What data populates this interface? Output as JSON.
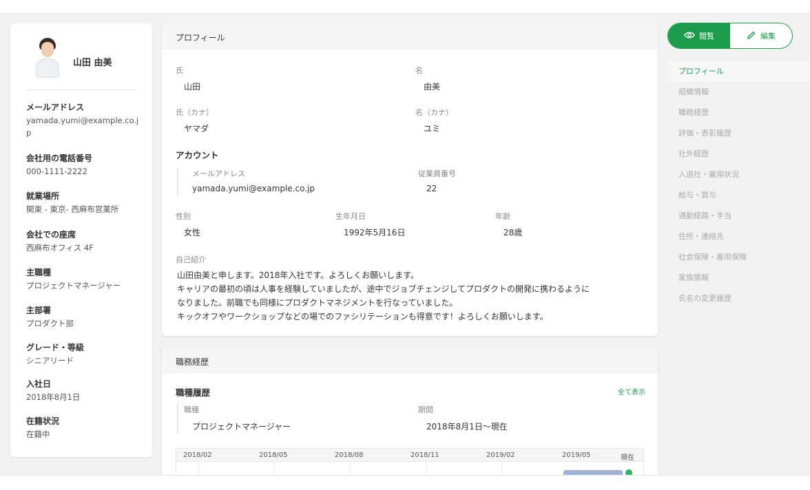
{
  "left": {
    "name": "山田 由美",
    "fields": [
      {
        "label": "メールアドレス",
        "value": "yamada.yumi@example.co.jp"
      },
      {
        "label": "会社用の電話番号",
        "value": "000-1111-2222"
      },
      {
        "label": "就業場所",
        "value": "関東 - 東京- 西麻布営業所"
      },
      {
        "label": "会社での座席",
        "value": "西麻布オフィス 4F"
      },
      {
        "label": "主職種",
        "value": "プロジェクトマネージャー"
      },
      {
        "label": "主部署",
        "value": "プロダクト部"
      },
      {
        "label": "グレード・等級",
        "value": "シニアリード"
      },
      {
        "label": "入社日",
        "value": "2018年8月1日"
      },
      {
        "label": "在籍状況",
        "value": "在籍中"
      }
    ]
  },
  "profile": {
    "header": "プロフィール",
    "last_name_label": "氏",
    "last_name": "山田",
    "first_name_label": "名",
    "first_name": "由美",
    "last_kana_label": "氏（カナ）",
    "last_kana": "ヤマダ",
    "first_kana_label": "名（カナ）",
    "first_kana": "ユミ",
    "account_title": "アカウント",
    "email_label": "メールアドレス",
    "email": "yamada.yumi@example.co.jp",
    "employee_no_label": "従業員番号",
    "employee_no": "22",
    "gender_label": "性別",
    "gender": "女性",
    "birthday_label": "生年月日",
    "birthday": "1992年5月16日",
    "age_label": "年齢",
    "age": "28歳",
    "intro_label": "自己紹介",
    "intro_lines": [
      "山田由美と申します。2018年入社です。よろしくお願いします。",
      "キャリアの最初の頃は人事を経験していましたが、途中でジョブチェンジしてプロダクトの開発に携わるように",
      "なりました。前職でも同様にプロダクトマネジメントを行なっていました。",
      "キックオフやワークショップなどの場でのファシリテーションも得意です！よろしくお願いします。"
    ]
  },
  "career": {
    "header": "職務経歴",
    "title": "職種履歴",
    "show_all": "全て表示",
    "job_label": "職種",
    "job": "プロジェクトマネージャー",
    "period_label": "期間",
    "period": "2018年8月1日〜現在",
    "timeline_ticks": [
      "2018/02",
      "2018/05",
      "2018/08",
      "2018/11",
      "2019/02",
      "2019/05",
      "現在"
    ]
  },
  "mode": {
    "view_label": "閲覧",
    "edit_label": "編集",
    "accent": "#1a9c4a"
  },
  "nav": [
    {
      "label": "プロフィール",
      "active": true
    },
    {
      "label": "組織情報"
    },
    {
      "label": "職務経歴"
    },
    {
      "label": "評価・表彰履歴"
    },
    {
      "label": "社外経歴"
    },
    {
      "label": "入退社・雇用状況"
    },
    {
      "label": "給与・賞与"
    },
    {
      "label": "通勤経路・手当"
    },
    {
      "label": "住所・連絡先"
    },
    {
      "label": "社会保険・雇用保険"
    },
    {
      "label": "家族情報"
    },
    {
      "label": "氏名の変更履歴"
    }
  ]
}
